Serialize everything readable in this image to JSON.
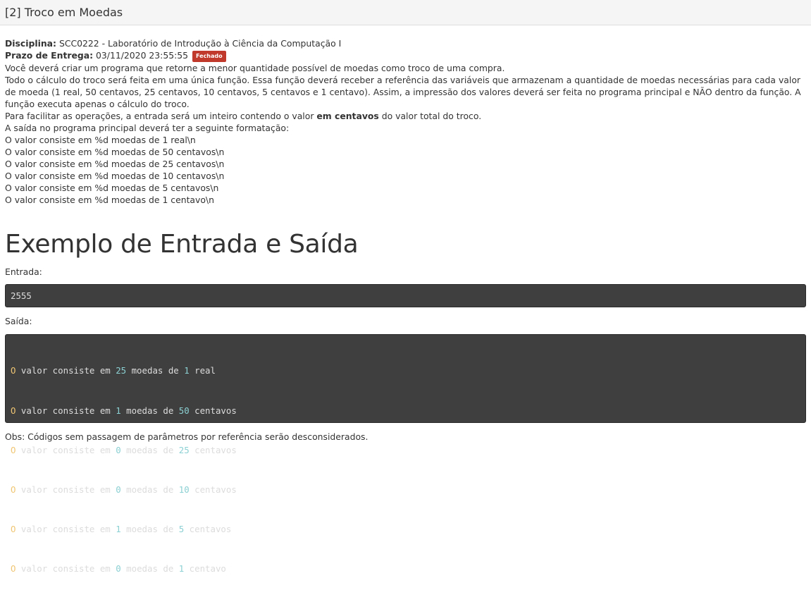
{
  "header": {
    "title": "[2] Troco em Moedas"
  },
  "info": {
    "disciplina_label": "Disciplina:",
    "disciplina_value": " SCC0222 - Laboratório de Introdução à Ciência da Computação I",
    "prazo_label": "Prazo de Entrega:",
    "prazo_value": " 03/11/2020 23:55:55",
    "status_badge": "Fechado",
    "p1": "Você deverá criar um programa que retorne a menor quantidade possível de moedas como troco de uma compra.",
    "p2": "Todo o cálculo do troco será feita em uma única função. Essa função deverá receber a referência das variáveis que armazenam a quantidade de moedas necessárias para cada valor de moeda (1 real, 50 centavos, 25 centavos, 10 centavos, 5 centavos e 1 centavo). Assim, a impressão dos valores deverá ser feita no programa principal e NÃO dentro da função. A função executa apenas o cálculo do troco.",
    "p3_before": "Para facilitar as operações, a entrada será um inteiro contendo o valor ",
    "p3_bold": "em centavos",
    "p3_after": " do valor total do troco.",
    "p4": "A saída no programa principal deverá ter a seguinte formatação:",
    "format_lines": [
      "O valor consiste em %d moedas de 1 real\\n",
      "O valor consiste em %d moedas de 50 centavos\\n",
      "O valor consiste em %d moedas de 25 centavos\\n",
      "O valor consiste em %d moedas de 10 centavos\\n",
      "O valor consiste em %d moedas de 5 centavos\\n",
      "O valor consiste em %d moedas de 1 centavo\\n"
    ]
  },
  "example": {
    "title": "Exemplo de Entrada e Saída",
    "input_label": "Entrada:",
    "input_value": "2555",
    "output_label": "Saída:",
    "output_lines": [
      {
        "o": "O",
        "a": " valor consiste em ",
        "n1": "25",
        "b": " moedas de ",
        "n2": "1",
        "c": " real"
      },
      {
        "o": "O",
        "a": " valor consiste em ",
        "n1": "1",
        "b": " moedas de ",
        "n2": "50",
        "c": " centavos"
      },
      {
        "o": "O",
        "a": " valor consiste em ",
        "n1": "0",
        "b": " moedas de ",
        "n2": "25",
        "c": " centavos"
      },
      {
        "o": "O",
        "a": " valor consiste em ",
        "n1": "0",
        "b": " moedas de ",
        "n2": "10",
        "c": " centavos"
      },
      {
        "o": "O",
        "a": " valor consiste em ",
        "n1": "1",
        "b": " moedas de ",
        "n2": "5",
        "c": " centavos"
      },
      {
        "o": "O",
        "a": " valor consiste em ",
        "n1": "0",
        "b": " moedas de ",
        "n2": "1",
        "c": " centavo"
      }
    ]
  },
  "obs": "Obs: Códigos sem passagem de parâmetros por referência serão desconsiderados."
}
